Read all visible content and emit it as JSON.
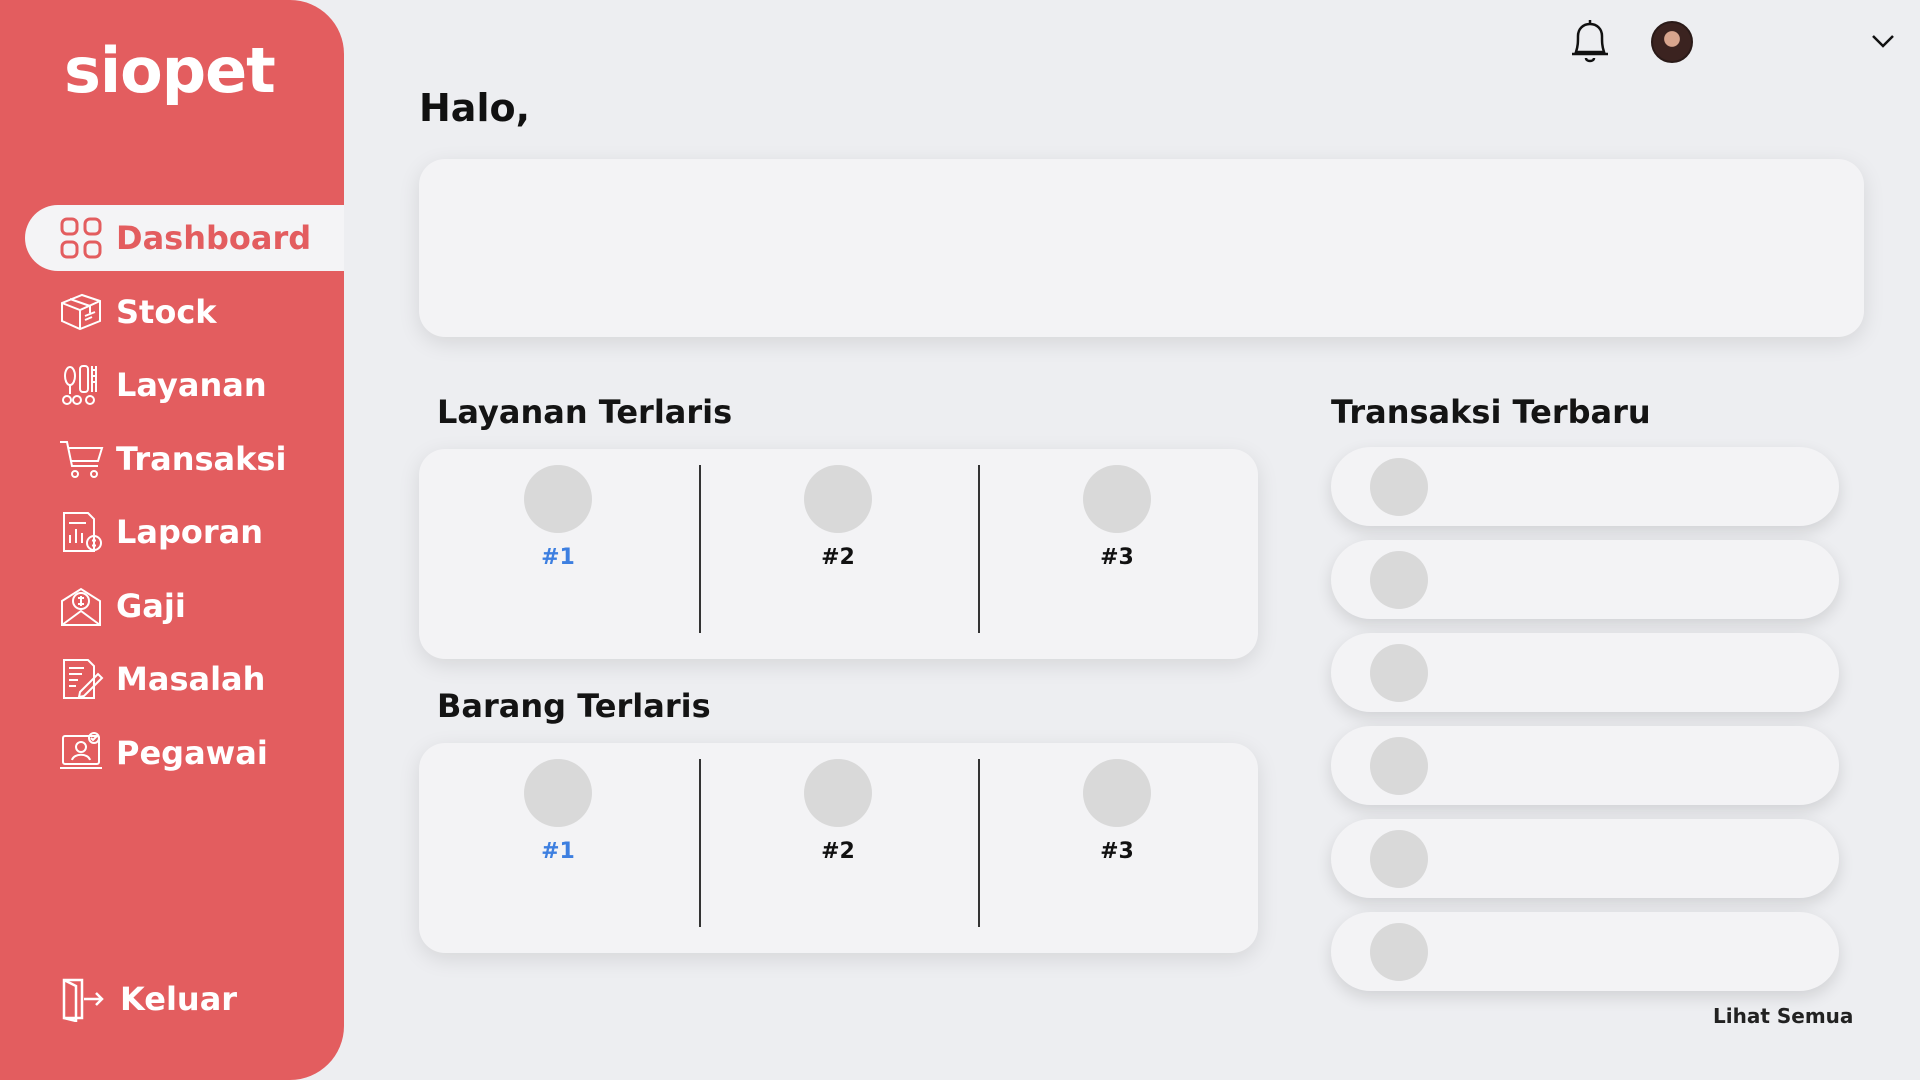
{
  "app": {
    "logo": "siopet"
  },
  "colors": {
    "brand": "#e35d5f",
    "accent_rank": "#3d7fe0",
    "background": "#edeef1",
    "card": "#f3f3f5"
  },
  "sidebar": {
    "items": [
      {
        "label": "Dashboard",
        "icon": "dashboard-grid-icon",
        "active": true
      },
      {
        "label": "Stock",
        "icon": "box-icon"
      },
      {
        "label": "Layanan",
        "icon": "grooming-tools-icon"
      },
      {
        "label": "Transaksi",
        "icon": "cart-icon"
      },
      {
        "label": "Laporan",
        "icon": "report-icon"
      },
      {
        "label": "Gaji",
        "icon": "salary-envelope-icon"
      },
      {
        "label": "Masalah",
        "icon": "issue-document-icon"
      },
      {
        "label": "Pegawai",
        "icon": "employee-icon"
      }
    ],
    "logout_label": "Keluar"
  },
  "header": {
    "notifications_icon": "bell-icon",
    "avatar_icon": "avatar",
    "menu_icon": "chevron-down-icon"
  },
  "main": {
    "greeting": "Halo,",
    "layanan_terlaris": {
      "title": "Layanan Terlaris",
      "ranks": [
        "#1",
        "#2",
        "#3"
      ]
    },
    "barang_terlaris": {
      "title": "Barang Terlaris",
      "ranks": [
        "#1",
        "#2",
        "#3"
      ]
    },
    "transaksi_terbaru": {
      "title": "Transaksi Terbaru",
      "see_all": "Lihat Semua"
    }
  }
}
